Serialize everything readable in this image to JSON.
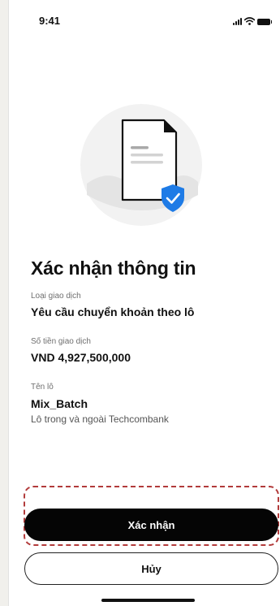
{
  "status_bar": {
    "time": "9:41",
    "icons": [
      "signal-icon",
      "wifi-icon",
      "battery-icon"
    ]
  },
  "illustration": {
    "icon": "document-verified-icon",
    "badge_icon": "shield-check-icon",
    "accent_color": "#1e7be6"
  },
  "title": "Xác nhận thông tin",
  "fields": {
    "transaction_type": {
      "label": "Loại giao dịch",
      "value": "Yêu cầu chuyển khoản theo lô"
    },
    "amount": {
      "label": "Số tiền giao dịch",
      "value": "VND 4,927,500,000"
    },
    "batch": {
      "label": "Tên lô",
      "value": "Mix_Batch",
      "description": "Lô trong và ngoài Techcombank"
    }
  },
  "actions": {
    "confirm_label": "Xác nhận",
    "cancel_label": "Hủy"
  },
  "colors": {
    "primary_button": "#050505",
    "highlight": "#b23b3b"
  }
}
